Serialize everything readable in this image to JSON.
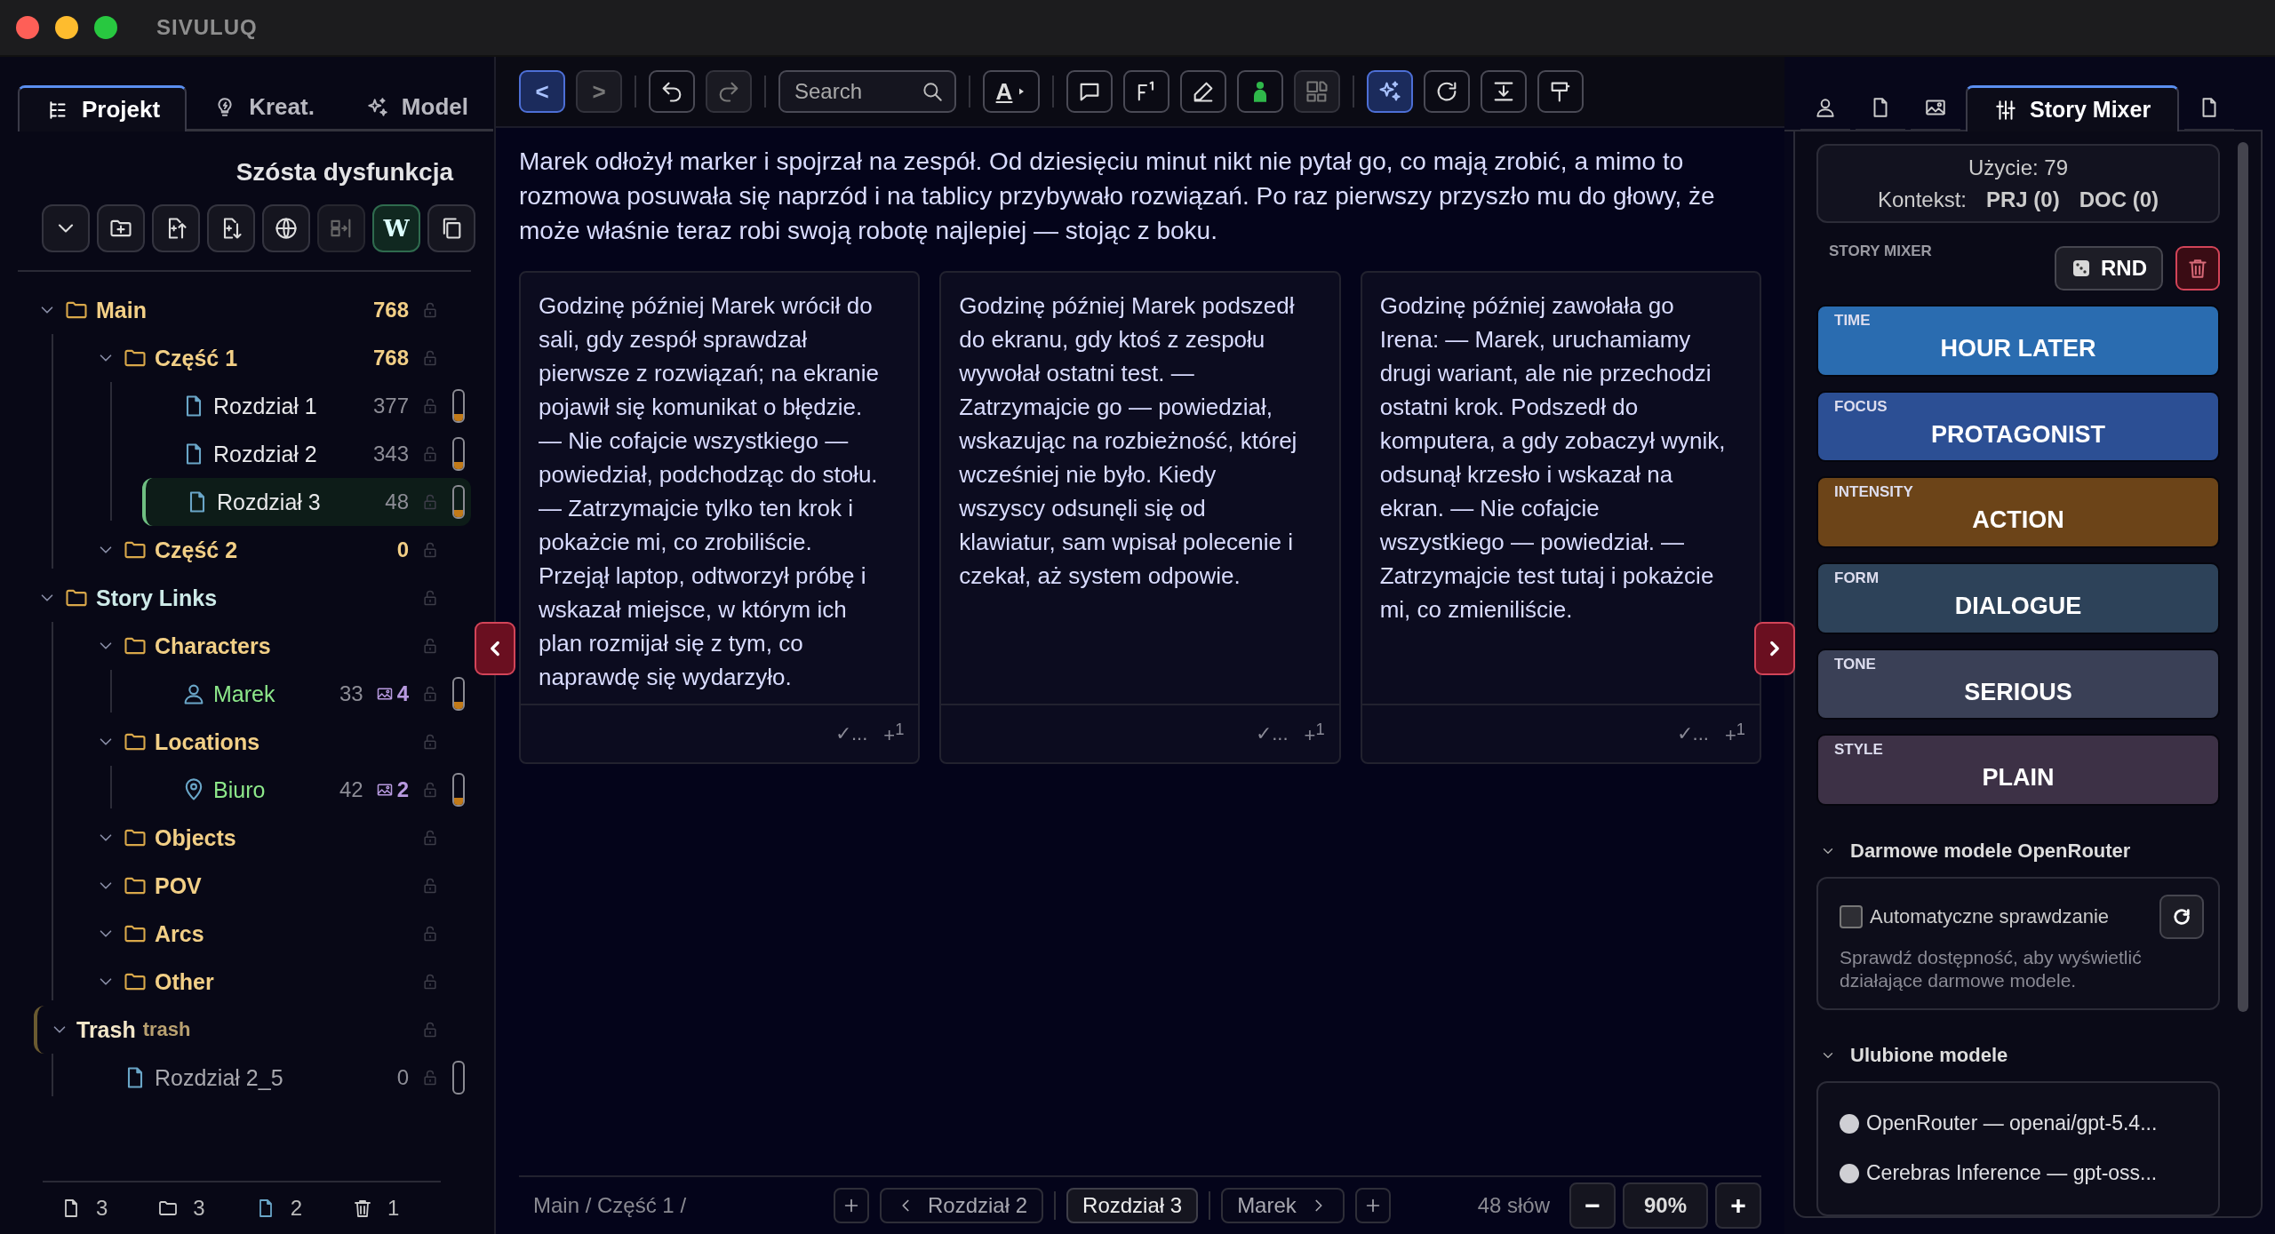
{
  "window": {
    "title": "SIVULUQ"
  },
  "sidebar": {
    "tabs": [
      {
        "label": "Projekt",
        "selected": true
      },
      {
        "label": "Kreat.",
        "selected": false
      },
      {
        "label": "Model",
        "selected": false
      }
    ],
    "project_title": "Szósta dysfunkcja",
    "toolbar": [
      {
        "kind": "collapse",
        "selected": false,
        "disabled": false
      },
      {
        "kind": "new-folder",
        "selected": false,
        "disabled": false
      },
      {
        "kind": "import",
        "selected": false,
        "disabled": false
      },
      {
        "kind": "export",
        "selected": false,
        "disabled": false
      },
      {
        "kind": "web",
        "selected": false,
        "disabled": false
      },
      {
        "kind": "split",
        "selected": false,
        "disabled": true
      },
      {
        "kind": "wiki",
        "label": "W",
        "selected": true,
        "disabled": false
      },
      {
        "kind": "copy",
        "selected": false,
        "disabled": false
      }
    ],
    "tree": [
      {
        "kind": "folder",
        "label": "Main",
        "count": "768",
        "expanded": true,
        "selected": false,
        "children": [
          {
            "kind": "folder",
            "label": "Część 1",
            "count": "768",
            "expanded": true,
            "selected": false,
            "children": [
              {
                "kind": "document",
                "label": "Rozdział 1",
                "count": "377",
                "selected": false,
                "level": 0.25
              },
              {
                "kind": "document",
                "label": "Rozdział 2",
                "count": "343",
                "selected": false,
                "level": 0.25
              },
              {
                "kind": "document",
                "label": "Rozdział 3",
                "count": "48",
                "selected": true,
                "level": 0.25
              }
            ]
          },
          {
            "kind": "folder",
            "label": "Część 2",
            "count": "0",
            "expanded": true,
            "selected": false
          }
        ]
      },
      {
        "kind": "links",
        "label": "Story Links",
        "expanded": true,
        "selected": false,
        "children": [
          {
            "kind": "folder",
            "label": "Characters",
            "expanded": true,
            "selected": false,
            "children": [
              {
                "kind": "character",
                "label": "Marek",
                "count": "33",
                "images": "4",
                "selected": false,
                "level": 0.25
              }
            ]
          },
          {
            "kind": "folder",
            "label": "Locations",
            "expanded": true,
            "selected": false,
            "children": [
              {
                "kind": "location",
                "label": "Biuro",
                "count": "42",
                "images": "2",
                "selected": false,
                "level": 0.25
              }
            ]
          },
          {
            "kind": "folder",
            "label": "Objects",
            "expanded": true,
            "selected": false
          },
          {
            "kind": "folder",
            "label": "POV",
            "expanded": true,
            "selected": false
          },
          {
            "kind": "folder",
            "label": "Arcs",
            "expanded": true,
            "selected": false
          },
          {
            "kind": "folder",
            "label": "Other",
            "expanded": true,
            "selected": false
          }
        ]
      },
      {
        "kind": "trash",
        "label": "Trash",
        "tag": "trash",
        "expanded": true,
        "selected": false,
        "children": [
          {
            "kind": "document",
            "label": "Rozdział 2_5",
            "count": "0",
            "selected": false,
            "level": 0
          }
        ]
      }
    ],
    "stats": [
      {
        "kind": "document",
        "value": "3"
      },
      {
        "kind": "folder",
        "value": "3"
      },
      {
        "kind": "linked",
        "value": "2"
      },
      {
        "kind": "trash",
        "value": "1"
      }
    ]
  },
  "editor": {
    "toolbar": [
      [
        {
          "kind": "back",
          "label": "<",
          "selected": true,
          "disabled": false
        },
        {
          "kind": "forward",
          "label": ">",
          "selected": false,
          "disabled": true
        }
      ],
      [
        {
          "kind": "undo",
          "selected": false,
          "disabled": false
        },
        {
          "kind": "redo",
          "selected": false,
          "disabled": true
        }
      ],
      [
        {
          "kind": "search",
          "placeholder": "Search"
        }
      ],
      [
        {
          "kind": "font",
          "label": "A",
          "selected": false,
          "disabled": false
        }
      ],
      [
        {
          "kind": "comment",
          "selected": false,
          "disabled": false
        },
        {
          "kind": "footnote",
          "selected": false,
          "disabled": false
        },
        {
          "kind": "pen",
          "selected": false,
          "disabled": false
        },
        {
          "kind": "person",
          "selected": false,
          "disabled": false
        },
        {
          "kind": "compare",
          "selected": false,
          "disabled": true
        }
      ],
      [
        {
          "kind": "sparkle",
          "selected": true,
          "disabled": false
        },
        {
          "kind": "refresh",
          "selected": false,
          "disabled": false
        },
        {
          "kind": "insert",
          "selected": false,
          "disabled": false
        },
        {
          "kind": "paint",
          "selected": false,
          "disabled": false
        }
      ]
    ],
    "paragraph": "Marek odłożył marker i spojrzał na zespół. Od dziesięciu minut nikt nie pytał go, co mają zrobić, a mimo to rozmowa posuwała się naprzód i na tablicy przybywało rozwiązań. Po raz pierwszy przyszło mu do głowy, że może właśnie teraz robi swoją robotę najlepiej — stojąc z boku.",
    "variants": [
      {
        "text": "Godzinę później Marek wrócił do sali, gdy zespół sprawdzał pierwsze z rozwiązań; na ekranie pojawił się komunikat o błędzie. — Nie cofajcie wszystkiego — powiedział, podchodząc do stołu. — Zatrzymajcie tylko ten krok i pokażcie mi, co zrobiliście. Przejął laptop, odtworzył próbę i wskazał miejsce, w którym ich plan rozmijał się z tym, co naprawdę się wydarzyło.",
        "accept": "✓...",
        "add": "+$^{1}$"
      },
      {
        "text": "Godzinę później Marek podszedł do ekranu, gdy ktoś z zespołu wywołał ostatni test. — Zatrzymajcie go — powiedział, wskazując na rozbieżność, której wcześniej nie było. Kiedy wszyscy odsunęli się od klawiatur, sam wpisał polecenie i czekał, aż system odpowie.",
        "accept": "✓...",
        "add": "+$^{1}$"
      },
      {
        "text": "Godzinę później zawołała go Irena: — Marek, uruchamiamy drugi wariant, ale nie przechodzi ostatni krok. Podszedł do komputera, a gdy zobaczył wynik, odsunął krzesło i wskazał na ekran. — Nie cofajcie wszystkiego — powiedział. — Zatrzymajcie test tutaj i pokażcie mi, co zmieniliście.",
        "accept": "✓...",
        "add": "+$^{1}$"
      }
    ]
  },
  "status_bar": {
    "breadcrumb": "Main / Część 1 /",
    "nav": [
      {
        "kind": "add"
      },
      {
        "kind": "prev",
        "label": "Rozdział 2",
        "selected": false
      },
      {
        "kind": "current",
        "label": "Rozdział 3",
        "selected": true
      },
      {
        "kind": "next",
        "label": "Marek",
        "selected": false
      },
      {
        "kind": "add"
      }
    ],
    "word_count": "48 słów",
    "zoom_out": "−",
    "zoom": "90%",
    "zoom_in": "+"
  },
  "inspector": {
    "tabs": [
      {
        "kind": "character",
        "selected": false
      },
      {
        "kind": "document",
        "selected": false
      },
      {
        "kind": "image",
        "selected": false
      },
      {
        "kind": "mixer",
        "label": "Story Mixer",
        "selected": true
      },
      {
        "kind": "notes",
        "selected": false
      }
    ],
    "usage": "Użycie: 79",
    "context_label": "Kontekst:",
    "context": [
      "PRJ (0)",
      "DOC (0)"
    ],
    "mixer_title": "STORY MIXER",
    "random_label": "RND",
    "mixer": [
      {
        "label": "TIME",
        "value": "HOUR LATER",
        "color": "#2a6cb0"
      },
      {
        "label": "FOCUS",
        "value": "PROTAGONIST",
        "color": "#2c4f94"
      },
      {
        "label": "INTENSITY",
        "value": "ACTION",
        "color": "#6c4418"
      },
      {
        "label": "FORM",
        "value": "DIALOGUE",
        "color": "#2d4259"
      },
      {
        "label": "TONE",
        "value": "SERIOUS",
        "color": "#3a4056"
      },
      {
        "label": "STYLE",
        "value": "PLAIN",
        "color": "#3d3146"
      }
    ],
    "sections": [
      {
        "kind": "free",
        "title": "Darmowe modele OpenRouter",
        "expanded": true,
        "auto_check": {
          "label": "Automatyczne sprawdzanie",
          "checked": false
        },
        "hint": "Sprawdź dostępność, aby wyświetlić działające darmowe modele."
      },
      {
        "kind": "favorites",
        "title": "Ulubione modele",
        "expanded": true,
        "models": [
          {
            "label": "OpenRouter — openai/gpt-5.4...",
            "selected": false
          },
          {
            "label": "Cerebras Inference — gpt-oss...",
            "selected": false
          }
        ]
      }
    ]
  }
}
